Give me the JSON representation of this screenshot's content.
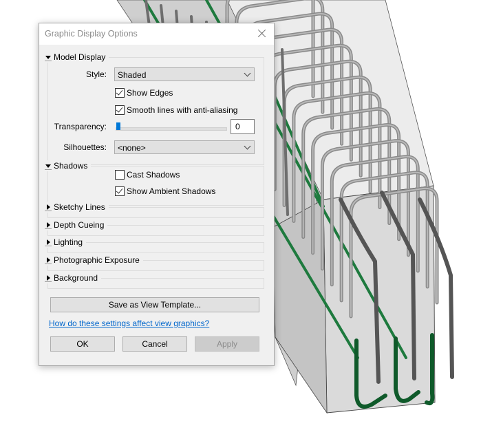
{
  "dialog": {
    "title": "Graphic Display Options",
    "close_icon": "close-icon",
    "sections": {
      "model_display": {
        "label": "Model Display",
        "expanded": true,
        "style_label": "Style:",
        "style_value": "Shaded",
        "show_edges": {
          "label": "Show Edges",
          "checked": true
        },
        "smooth_lines": {
          "label": "Smooth lines with anti-aliasing",
          "checked": true
        },
        "transparency_label": "Transparency:",
        "transparency_value": "0",
        "transparency_percent": 0,
        "silhouettes_label": "Silhouettes:",
        "silhouettes_value": "<none>"
      },
      "shadows": {
        "label": "Shadows",
        "expanded": true,
        "cast_shadows": {
          "label": "Cast Shadows",
          "checked": false
        },
        "ambient_shadows": {
          "label": "Show Ambient Shadows",
          "checked": true
        }
      },
      "sketchy_lines": {
        "label": "Sketchy Lines",
        "expanded": false
      },
      "depth_cueing": {
        "label": "Depth Cueing",
        "expanded": false
      },
      "lighting": {
        "label": "Lighting",
        "expanded": false
      },
      "photographic_exposure": {
        "label": "Photographic Exposure",
        "expanded": false
      },
      "background": {
        "label": "Background",
        "expanded": false
      }
    },
    "save_template_label": "Save as View Template...",
    "help_link": "How do these settings affect view graphics?",
    "ok_label": "OK",
    "cancel_label": "Cancel",
    "apply_label": "Apply",
    "apply_enabled": false
  },
  "viewport": {
    "description": "3D view of reinforced concrete beam with rebar cage",
    "colors": {
      "rebar_gray": "#6e6e6e",
      "rebar_green": "#1e7a3e",
      "concrete_face": "#d6d6d6",
      "concrete_top": "#ececec"
    }
  }
}
